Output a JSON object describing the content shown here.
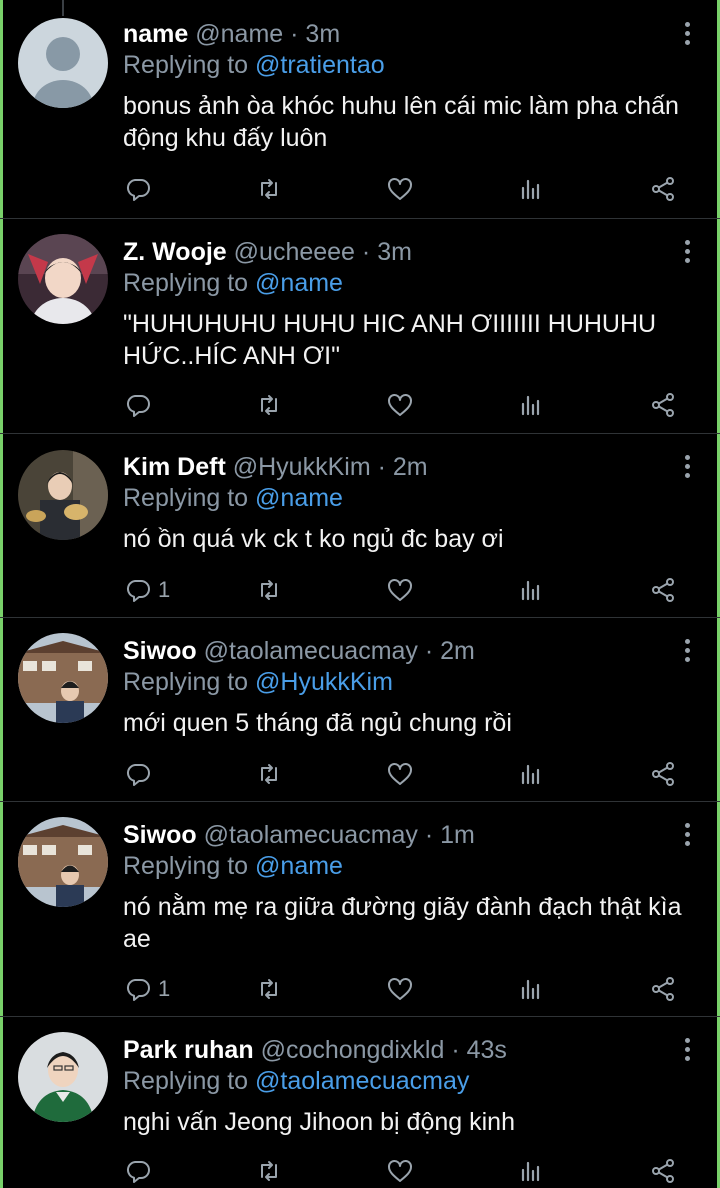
{
  "colors": {
    "background": "#000000",
    "mention": "#4a9ee8",
    "muted": "#8b98a5",
    "separator": "#2f3336",
    "edge": "#79d06a"
  },
  "tweets": [
    {
      "name": "name",
      "handle": "@name",
      "time": "3m",
      "replying_prefix": "Replying to",
      "replying_to": "@tratientao",
      "text": "bonus ảnh òa khóc huhu lên cái mic làm pha chấn động khu đấy luôn",
      "reply_count": "",
      "avatar": "default-avatar"
    },
    {
      "name": "Z. Wooje",
      "handle": "@ucheeee",
      "time": "3m",
      "replying_prefix": "Replying to",
      "replying_to": "@name",
      "text": "\"HUHUHUHU HUHU HIC ANH ƠIIIIIII HUHUHU HỨC..HÍC ANH ƠI\"",
      "reply_count": "",
      "avatar": "photo-avatar"
    },
    {
      "name": "Kim Deft",
      "handle": "@HyukkKim",
      "time": "2m",
      "replying_prefix": "Replying to",
      "replying_to": "@name",
      "text": "nó ồn quá vk ck t ko ngủ đc bay ơi",
      "reply_count": "1",
      "avatar": "photo-avatar"
    },
    {
      "name": "Siwoo",
      "handle": "@taolamecuacmay",
      "time": "2m",
      "replying_prefix": "Replying to",
      "replying_to": "@HyukkKim",
      "text": "mới quen 5 tháng đã ngủ chung rồi",
      "reply_count": "",
      "avatar": "photo-avatar"
    },
    {
      "name": "Siwoo",
      "handle": "@taolamecuacmay",
      "time": "1m",
      "replying_prefix": "Replying to",
      "replying_to": "@name",
      "text": "nó nằm mẹ ra giữa đường giãy đành đạch thật kìa ae",
      "reply_count": "1",
      "avatar": "photo-avatar"
    },
    {
      "name": "Park ruhan",
      "handle": "@cochongdixkld",
      "time": "43s",
      "replying_prefix": "Replying to",
      "replying_to": "@taolamecuacmay",
      "text": "nghi vấn Jeong Jihoon bị động kinh",
      "reply_count": "",
      "avatar": "photo-avatar"
    }
  ]
}
